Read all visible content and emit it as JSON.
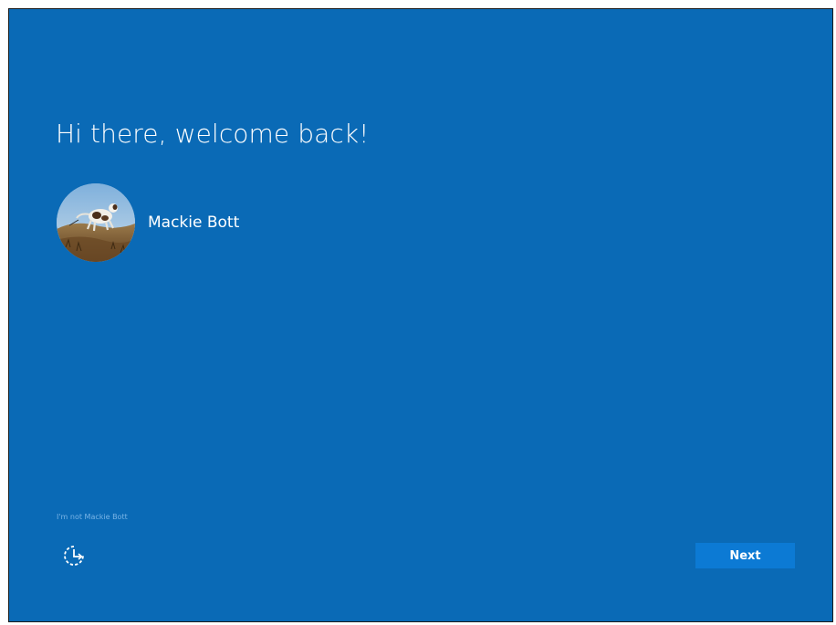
{
  "screen": {
    "background_color": "#0a6ab6",
    "accent_color": "#0c7ad4",
    "title": "Hi there, welcome back!"
  },
  "user": {
    "name": "Mackie Bott",
    "avatar_icon": "dog-photo-avatar"
  },
  "footer": {
    "not_user_link": "I'm not Mackie Bott",
    "ease_of_access_icon": "ease-of-access-icon",
    "next_label": "Next"
  }
}
